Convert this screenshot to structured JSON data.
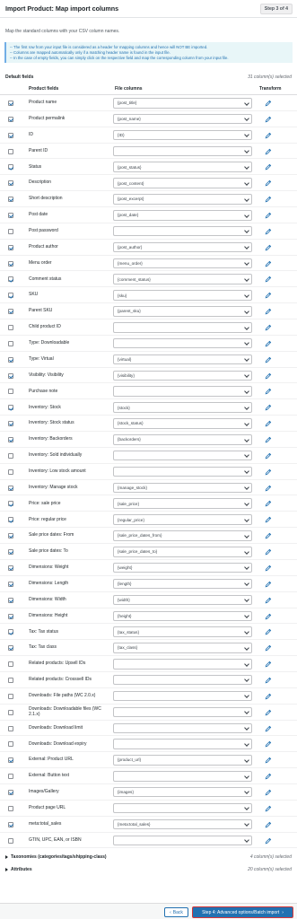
{
  "header": {
    "title": "Import Product: Map import columns",
    "step": "Step 3 of 4"
  },
  "subtitle": "Map the standard columns with your CSV column names.",
  "notice": [
    "-- The first row from your input file is considered as a header for mapping columns and hence will NOT BE imported.",
    "-- Columns are mapped automatically only if a matching header name is found in the input file.",
    "-- In the case of empty fields, you can simply click on the respective field and map the corresponding column from your input file."
  ],
  "default_fields": {
    "label": "Default fields",
    "count": "31 column(s) selected"
  },
  "columns": {
    "product_fields": "Product fields",
    "file_columns": "File columns",
    "transform": "Transform"
  },
  "rows": [
    {
      "label": "Product name",
      "value": "{post_title}",
      "checked": true
    },
    {
      "label": "Product permalink",
      "value": "{post_name}",
      "checked": true
    },
    {
      "label": "ID",
      "value": "{ID}",
      "checked": true
    },
    {
      "label": "Parent ID",
      "value": "",
      "checked": false
    },
    {
      "label": "Status",
      "value": "{post_status}",
      "checked": true
    },
    {
      "label": "Description",
      "value": "{post_content}",
      "checked": true
    },
    {
      "label": "Short description",
      "value": "{post_excerpt}",
      "checked": true
    },
    {
      "label": "Post date",
      "value": "{post_date}",
      "checked": true
    },
    {
      "label": "Post password",
      "value": "",
      "checked": false
    },
    {
      "label": "Product author",
      "value": "{post_author}",
      "checked": true
    },
    {
      "label": "Menu order",
      "value": "{menu_order}",
      "checked": true
    },
    {
      "label": "Comment status",
      "value": "{comment_status}",
      "checked": true
    },
    {
      "label": "SKU",
      "value": "{sku}",
      "checked": true
    },
    {
      "label": "Parent SKU",
      "value": "{parent_sku}",
      "checked": true
    },
    {
      "label": "Child product ID",
      "value": "",
      "checked": false
    },
    {
      "label": "Type: Downloadable",
      "value": "",
      "checked": false
    },
    {
      "label": "Type: Virtual",
      "value": "{virtual}",
      "checked": true
    },
    {
      "label": "Visibility: Visibility",
      "value": "{visibility}",
      "checked": true
    },
    {
      "label": "Purchase note",
      "value": "",
      "checked": false
    },
    {
      "label": "Inventory: Stock",
      "value": "{stock}",
      "checked": true
    },
    {
      "label": "Inventory: Stock status",
      "value": "{stock_status}",
      "checked": true
    },
    {
      "label": "Inventory: Backorders",
      "value": "{backorders}",
      "checked": true
    },
    {
      "label": "Inventory: Sold individually",
      "value": "",
      "checked": false
    },
    {
      "label": "Inventory: Low stock amount",
      "value": "",
      "checked": false
    },
    {
      "label": "Inventory: Manage stock",
      "value": "{manage_stock}",
      "checked": true
    },
    {
      "label": "Price: sale price",
      "value": "{sale_price}",
      "checked": true
    },
    {
      "label": "Price: regular price",
      "value": "{regular_price}",
      "checked": true
    },
    {
      "label": "Sale price dates: From",
      "value": "{sale_price_dates_from}",
      "checked": true
    },
    {
      "label": "Sale price dates: To",
      "value": "{sale_price_dates_to}",
      "checked": true
    },
    {
      "label": "Dimensions: Weight",
      "value": "{weight}",
      "checked": true
    },
    {
      "label": "Dimensions: Length",
      "value": "{length}",
      "checked": true
    },
    {
      "label": "Dimensions: Width",
      "value": "{width}",
      "checked": true
    },
    {
      "label": "Dimensions: Height",
      "value": "{height}",
      "checked": true
    },
    {
      "label": "Tax: Tax status",
      "value": "{tax_status}",
      "checked": true
    },
    {
      "label": "Tax: Tax class",
      "value": "{tax_class}",
      "checked": true
    },
    {
      "label": "Related products: Upsell IDs",
      "value": "",
      "checked": false
    },
    {
      "label": "Related products: Crosssell IDs",
      "value": "",
      "checked": false
    },
    {
      "label": "Downloads: File paths (WC 2.0.x)",
      "value": "",
      "checked": false
    },
    {
      "label": "Downloads: Downloadable files (WC 2.1.x)",
      "value": "",
      "checked": false
    },
    {
      "label": "Downloads: Download limit",
      "value": "",
      "checked": false
    },
    {
      "label": "Downloads: Download expiry",
      "value": "",
      "checked": false
    },
    {
      "label": "External: Product URL",
      "value": "{product_url}",
      "checked": true
    },
    {
      "label": "External: Button text",
      "value": "",
      "checked": false
    },
    {
      "label": "Images/Gallery",
      "value": "{images}",
      "checked": true
    },
    {
      "label": "Product page URL",
      "value": "",
      "checked": false
    },
    {
      "label": "meta:total_sales",
      "value": "{meta:total_sales}",
      "checked": true
    },
    {
      "label": "GTIN, UPC, EAN, or ISBN",
      "value": "",
      "checked": false
    }
  ],
  "taxonomies": {
    "label": "Taxonomies (categories/tags/shipping-class)",
    "count": "4 column(s) selected"
  },
  "attributes": {
    "label": "Attributes",
    "count": "20 column(s) selected"
  },
  "buttons": {
    "back": "Back",
    "next": "Step 4: Advanced options/Batch import"
  },
  "icons": {
    "transform": "edit-pencil-icon",
    "back": "chevron-left-icon",
    "next": "chevron-right-icon",
    "expand": "triangle-right-icon"
  },
  "colors": {
    "accent": "#2271b1",
    "notice_bg": "#e8f6f8",
    "highlight_border": "#d63638"
  }
}
